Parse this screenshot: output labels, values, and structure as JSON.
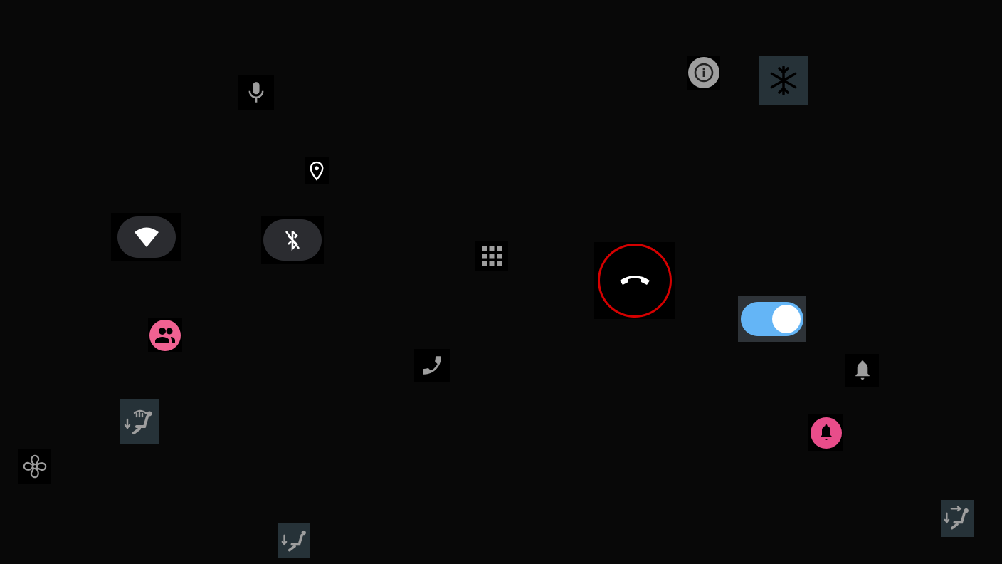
{
  "controls": {
    "microphone": {
      "icon": "microphone-icon"
    },
    "location": {
      "icon": "location-pin-icon"
    },
    "info": {
      "icon": "info-icon"
    },
    "defrost": {
      "icon": "snowflake-icon"
    },
    "wifi": {
      "icon": "wifi-icon",
      "state": "on"
    },
    "bluetooth": {
      "icon": "bluetooth-off-icon",
      "state": "off"
    },
    "dialpad": {
      "icon": "dialpad-icon"
    },
    "hangup": {
      "icon": "call-end-icon"
    },
    "toggle": {
      "state": "on"
    },
    "contacts": {
      "icon": "people-icon"
    },
    "phone": {
      "icon": "phone-icon"
    },
    "notifications": {
      "icon": "bell-icon"
    },
    "notifications_alert": {
      "icon": "bell-icon"
    },
    "seat_heat": {
      "icon": "seat-windshield-airflow-icon"
    },
    "fan": {
      "icon": "fan-icon"
    },
    "seat_airflow_down": {
      "icon": "seat-airflow-down-icon"
    },
    "seat_airflow_mixed": {
      "icon": "seat-airflow-forward-down-icon"
    }
  },
  "colors": {
    "background": "#080808",
    "hangup_ring": "#d50000",
    "toggle_track": "#64b5f6",
    "pink_accent": "#f06292",
    "pink_bell": "#e84d8a",
    "pill": "#2b2c30",
    "icon_gray": "#9e9e9e"
  }
}
